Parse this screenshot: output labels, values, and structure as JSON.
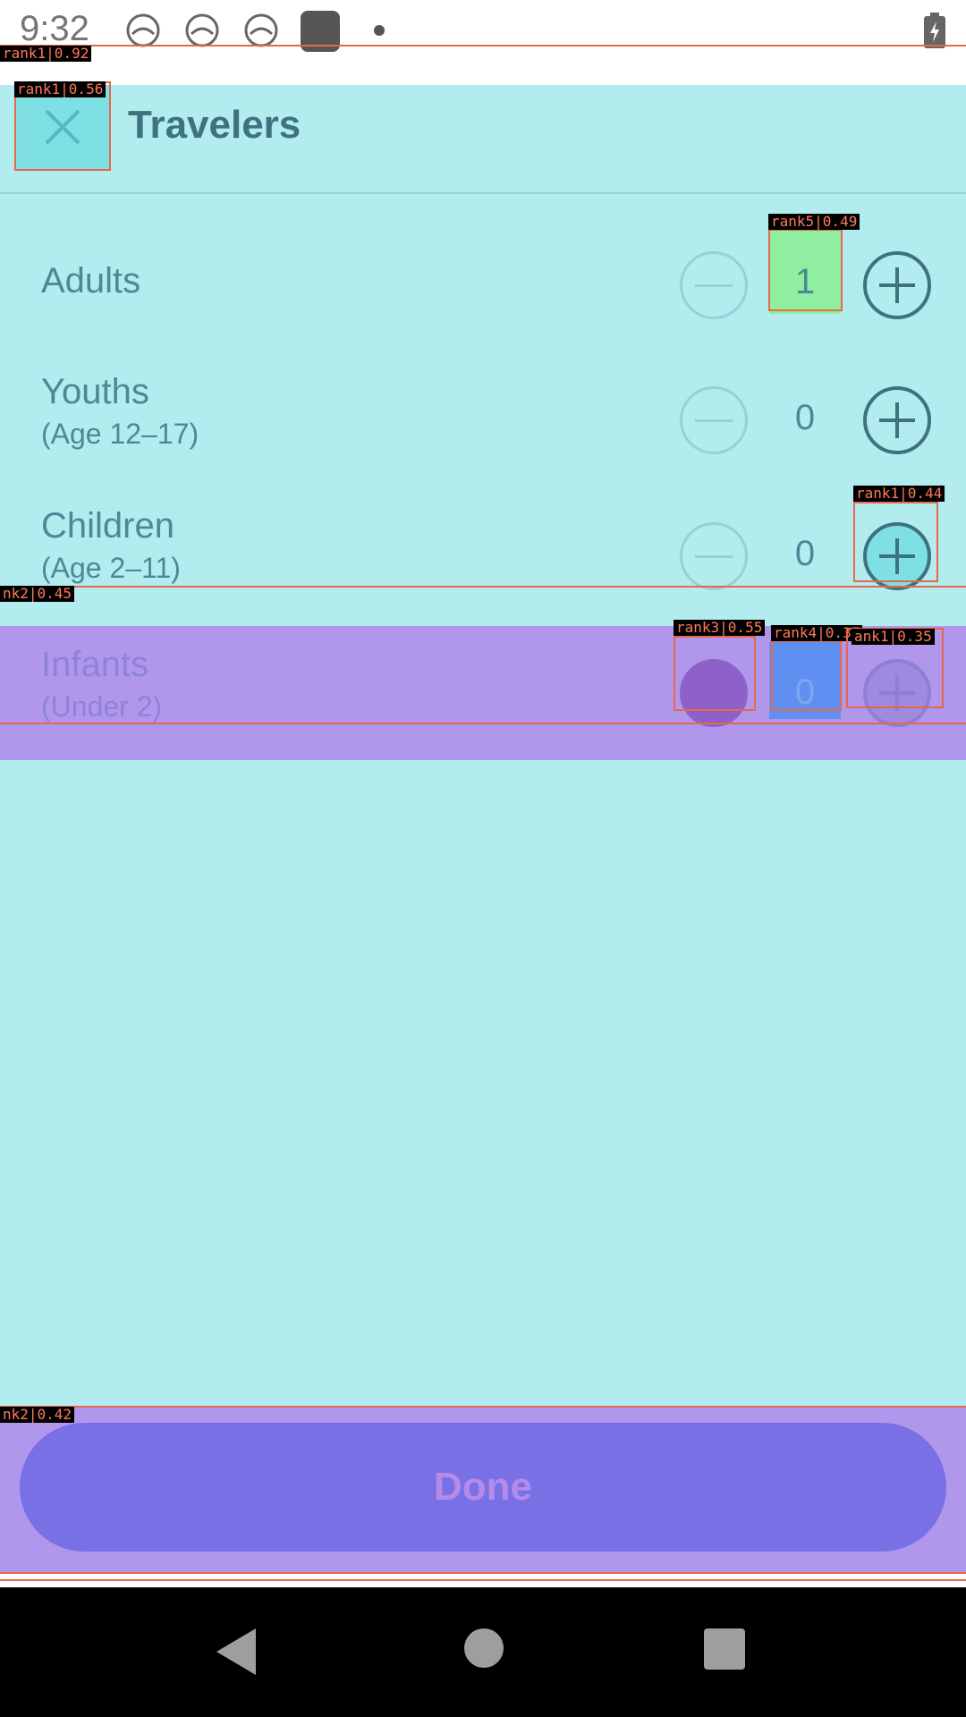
{
  "status_bar": {
    "time": "9:32",
    "icons": [
      "notification-icon",
      "notification-icon",
      "notification-icon",
      "notification-icon",
      "dot-icon",
      "battery-charging-icon"
    ]
  },
  "header": {
    "close_icon": "close-icon",
    "title": "Travelers"
  },
  "rows": [
    {
      "label": "Adults",
      "sublabel": "",
      "count": "1"
    },
    {
      "label": "Youths",
      "sublabel": "(Age 12–17)",
      "count": "0"
    },
    {
      "label": "Children",
      "sublabel": "(Age 2–11)",
      "count": "0"
    },
    {
      "label": "Infants",
      "sublabel": "(Under 2)",
      "count": "0"
    }
  ],
  "done_label": "Done",
  "annotations": [
    "rank1|0.92",
    "rank1|0.56",
    "rank5|0.49",
    "rank1|0.44",
    "nk2|0.45",
    "rank3|0.55",
    "rank4|0.37",
    "ank1|0.35",
    "nk2|0.42"
  ],
  "colors": {
    "app_bg": "#b2ecee",
    "title": "#3d7380",
    "highlight_purple": "#b197ec",
    "done_button": "#7a70e6",
    "annotation": "#e8674a"
  }
}
